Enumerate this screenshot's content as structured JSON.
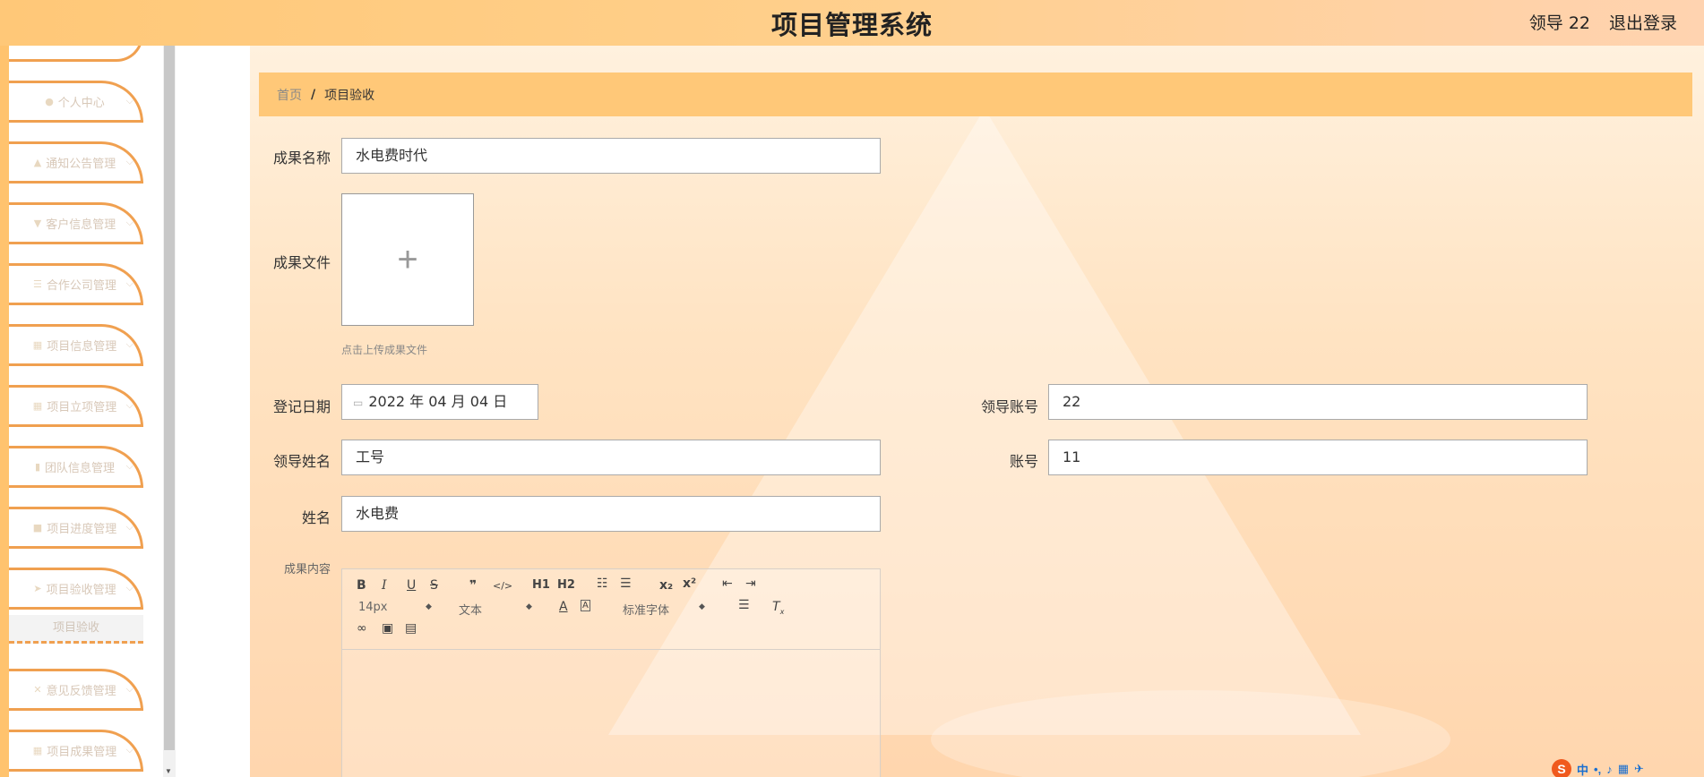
{
  "header": {
    "title": "项目管理系统",
    "user": "领导 22",
    "logout": "退出登录"
  },
  "sidebar": {
    "items": [
      {
        "label": "个人中心",
        "icon": "person-icon"
      },
      {
        "label": "通知公告管理",
        "icon": "thumb-icon"
      },
      {
        "label": "客户信息管理",
        "icon": "cup-icon"
      },
      {
        "label": "合作公司管理",
        "icon": "sliders-icon"
      },
      {
        "label": "项目信息管理",
        "icon": "grid-icon"
      },
      {
        "label": "项目立项管理",
        "icon": "grid-icon"
      },
      {
        "label": "团队信息管理",
        "icon": "chart-icon"
      },
      {
        "label": "项目进度管理",
        "icon": "chat-icon"
      },
      {
        "label": "项目验收管理",
        "icon": "send-icon"
      },
      {
        "label": "意见反馈管理",
        "icon": "ticket-icon"
      },
      {
        "label": "项目成果管理",
        "icon": "grid-icon"
      }
    ],
    "active_sub": "项目验收"
  },
  "breadcrumb": {
    "home": "首页",
    "separator": "/",
    "current": "项目验收"
  },
  "form": {
    "achievement_name": {
      "label": "成果名称",
      "value": "水电费时代"
    },
    "achievement_file": {
      "label": "成果文件",
      "hint": "点击上传成果文件",
      "plus": "+"
    },
    "register_date": {
      "label": "登记日期",
      "value": "2022 年 04 月 04 日"
    },
    "leader_account": {
      "label": "领导账号",
      "value": "22"
    },
    "leader_name": {
      "label": "领导姓名",
      "value": "工号"
    },
    "account": {
      "label": "账号",
      "value": "11"
    },
    "name": {
      "label": "姓名",
      "value": "水电费"
    },
    "content": {
      "label": "成果内容"
    }
  },
  "editor": {
    "font_size": "14px",
    "heading": "文本",
    "font_family": "标准字体",
    "buttons": {
      "bold": "B",
      "italic": "I",
      "underline": "U",
      "strike": "S",
      "quote": "❞",
      "code": "</>",
      "h1": "H1",
      "h2": "H2",
      "sub": "x₂",
      "sup": "x²"
    }
  },
  "tray": {
    "ime": "中"
  }
}
